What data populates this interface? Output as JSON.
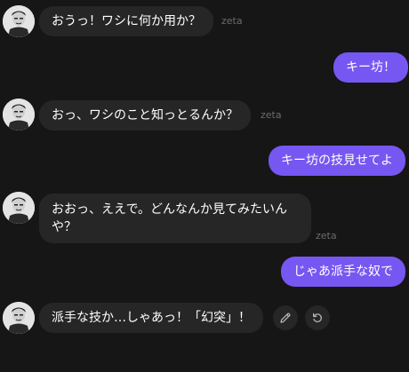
{
  "chat": {
    "messages": [
      {
        "role": "bot",
        "text": "おうっ！ワシに何か用か？",
        "sender": "zeta"
      },
      {
        "role": "user",
        "text": "キー坊！"
      },
      {
        "role": "bot",
        "text": "おっ、ワシのこと知っとるんか？",
        "sender": "zeta"
      },
      {
        "role": "user",
        "text": "キー坊の技見せてよ"
      },
      {
        "role": "bot",
        "text": "おおっ、ええで。どんなんか見てみたいんや？",
        "sender": "zeta"
      },
      {
        "role": "user",
        "text": "じゃあ派手な奴で"
      },
      {
        "role": "bot",
        "text": "派手な技か…しゃあっ！「幻突」！"
      }
    ]
  },
  "actions": {
    "edit_icon": "pencil-icon",
    "regenerate_icon": "regenerate-icon"
  },
  "colors": {
    "background": "#161616",
    "bot_bubble": "#262626",
    "user_bubble": "#7657f1",
    "sender_label": "#6c6c6c"
  }
}
